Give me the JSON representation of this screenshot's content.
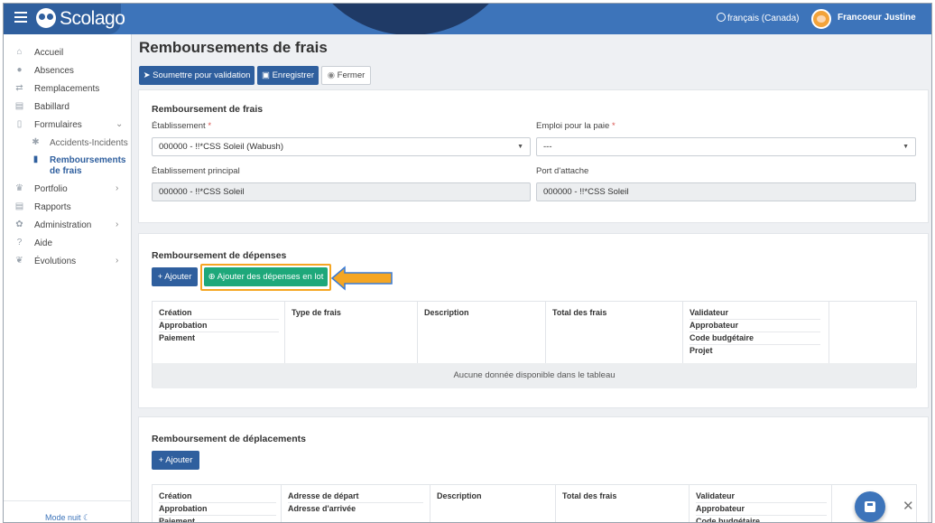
{
  "brand": {
    "name": "Scolago"
  },
  "topbar": {
    "language": "français (Canada)",
    "user_name": "Francoeur Justine"
  },
  "sidebar": {
    "items": [
      {
        "label": "Accueil",
        "icon": "home-icon"
      },
      {
        "label": "Absences",
        "icon": "user-icon"
      },
      {
        "label": "Remplacements",
        "icon": "replace-icon"
      },
      {
        "label": "Babillard",
        "icon": "board-icon"
      },
      {
        "label": "Formulaires",
        "icon": "document-icon"
      },
      {
        "label": "Accidents-Incidents",
        "icon": "accident-icon"
      },
      {
        "label": "Remboursements de frais",
        "icon": "document-icon"
      },
      {
        "label": "Portfolio",
        "icon": "trophy-icon"
      },
      {
        "label": "Rapports",
        "icon": "report-icon"
      },
      {
        "label": "Administration",
        "icon": "gear-icon"
      },
      {
        "label": "Aide",
        "icon": "question-icon"
      },
      {
        "label": "Évolutions",
        "icon": "sprout-icon"
      }
    ],
    "night_mode": "Mode nuit"
  },
  "page": {
    "title": "Remboursements de frais"
  },
  "toolbar": {
    "submit": "Soumettre pour validation",
    "save": "Enregistrer",
    "close": "Fermer"
  },
  "section1": {
    "title": "Remboursement de frais",
    "etablissement_label": "Établissement",
    "etablissement_value": "000000 - !!*CSS Soleil (Wabush)",
    "emploi_label": "Emploi pour la paie",
    "emploi_value": "---",
    "principal_label": "Établissement principal",
    "principal_value": "000000 - !!*CSS Soleil",
    "port_label": "Port d'attache",
    "port_value": "000000 - !!*CSS Soleil"
  },
  "section2": {
    "title": "Remboursement de dépenses",
    "add": "+ Ajouter",
    "add_batch": "Ajouter des dépenses en lot",
    "headers": {
      "c1": [
        "Création",
        "Approbation",
        "Paiement"
      ],
      "c2": "Type de frais",
      "c3": "Description",
      "c4": "Total des frais",
      "c5": [
        "Validateur",
        "Approbateur",
        "Code budgétaire",
        "Projet"
      ]
    },
    "empty": "Aucune donnée disponible dans le tableau"
  },
  "section3": {
    "title": "Remboursement de déplacements",
    "add": "+ Ajouter",
    "headers": {
      "c1": [
        "Création",
        "Approbation",
        "Paiement"
      ],
      "c2": [
        "Adresse de départ",
        "Adresse d'arrivée"
      ],
      "c3": "Description",
      "c4": "Total des frais",
      "c5": [
        "Validateur",
        "Approbateur",
        "Code budgétaire"
      ]
    }
  },
  "colors": {
    "primary": "#2f5f9e",
    "topbar": "#3d74ba",
    "green": "#1ea87a",
    "highlight": "#f5a623"
  }
}
